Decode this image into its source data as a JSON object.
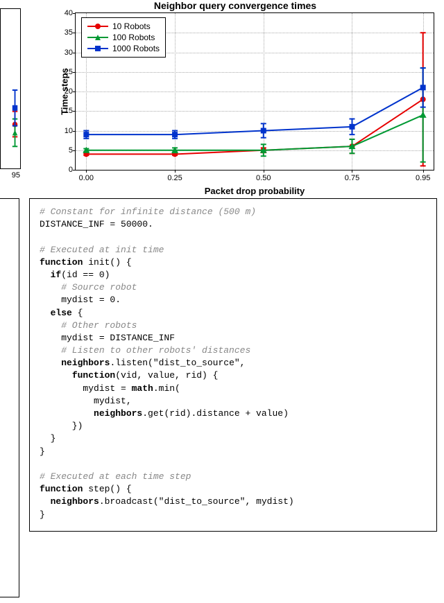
{
  "chart_data": {
    "type": "line",
    "title": "Neighbor query convergence times",
    "xlabel": "Packet drop probability",
    "ylabel": "Time steps",
    "x": [
      0.0,
      0.25,
      0.5,
      0.75,
      0.95
    ],
    "x_ticks": [
      "0.00",
      "0.25",
      "0.50",
      "0.75",
      "0.95"
    ],
    "y_ticks": [
      0,
      5,
      10,
      15,
      20,
      25,
      30,
      35,
      40
    ],
    "ylim": [
      0,
      40
    ],
    "xlim": [
      -0.03,
      0.98
    ],
    "series": [
      {
        "name": "10 Robots",
        "color": "#e60000",
        "marker": "circle",
        "values": [
          4,
          4,
          5,
          6,
          18
        ],
        "errors": [
          0.3,
          0.3,
          0.6,
          1.8,
          17
        ]
      },
      {
        "name": "100 Robots",
        "color": "#009933",
        "marker": "triangle",
        "values": [
          5,
          5,
          5,
          6,
          14
        ],
        "errors": [
          0.4,
          0.6,
          1.5,
          1.8,
          12
        ]
      },
      {
        "name": "1000 Robots",
        "color": "#0033cc",
        "marker": "square",
        "values": [
          9,
          9,
          10,
          11,
          21
        ],
        "errors": [
          1.0,
          1.0,
          1.8,
          2.0,
          5
        ]
      }
    ]
  },
  "code": {
    "lines": [
      {
        "kind": "comment",
        "text": "# Constant for infinite distance (500 m)"
      },
      {
        "kind": "plain",
        "text": "DISTANCE_INF = 50000."
      },
      {
        "kind": "blank",
        "text": ""
      },
      {
        "kind": "comment",
        "text": "# Executed at init time"
      },
      {
        "kind": "kw",
        "text": "function",
        "rest": " init() {"
      },
      {
        "kind": "indent",
        "text": "  ",
        "kw": "if",
        "rest": "(id == 0)"
      },
      {
        "kind": "comment",
        "text": "    # Source robot"
      },
      {
        "kind": "plain",
        "text": "    mydist = 0."
      },
      {
        "kind": "indent",
        "text": "  ",
        "kw": "else",
        "rest": " {"
      },
      {
        "kind": "comment",
        "text": "    # Other robots"
      },
      {
        "kind": "plain",
        "text": "    mydist = DISTANCE_INF"
      },
      {
        "kind": "comment",
        "text": "    # Listen to other robots' distances"
      },
      {
        "kind": "indent",
        "text": "    ",
        "kw": "neighbors",
        "rest": ".listen(\"dist_to_source\","
      },
      {
        "kind": "indent",
        "text": "      ",
        "kw": "function",
        "rest": "(vid, value, rid) {"
      },
      {
        "kind": "indent",
        "text": "        mydist = ",
        "kw": "math",
        "rest": ".min("
      },
      {
        "kind": "plain",
        "text": "          mydist,"
      },
      {
        "kind": "indent",
        "text": "          ",
        "kw": "neighbors",
        "rest": ".get(rid).distance + value)"
      },
      {
        "kind": "plain",
        "text": "      })"
      },
      {
        "kind": "plain",
        "text": "  }"
      },
      {
        "kind": "plain",
        "text": "}"
      },
      {
        "kind": "blank",
        "text": ""
      },
      {
        "kind": "comment",
        "text": "# Executed at each time step"
      },
      {
        "kind": "kw",
        "text": "function",
        "rest": " step() {"
      },
      {
        "kind": "indent",
        "text": "  ",
        "kw": "neighbors",
        "rest": ".broadcast(\"dist_to_source\", mydist)"
      },
      {
        "kind": "plain",
        "text": "}"
      }
    ]
  },
  "sliver": {
    "x_tick": "95"
  }
}
